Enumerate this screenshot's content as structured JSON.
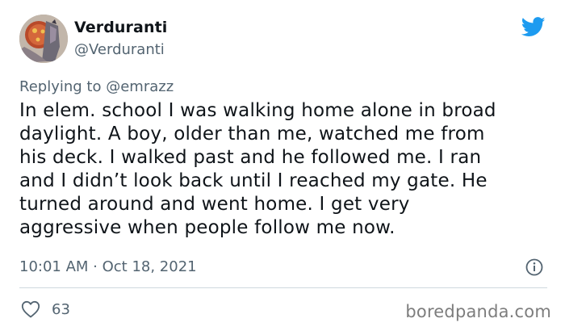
{
  "tweet": {
    "author": {
      "display_name": "Verduranti",
      "handle": "@Verduranti",
      "avatar": "avatar-portrait"
    },
    "platform_icon": "twitter-bird-icon",
    "reply": {
      "prefix": "Replying to",
      "mention": "@emrazz"
    },
    "text_lines": [
      "In elem. school I was walking home alone in broad",
      "daylight. A boy, older than me, watched me from",
      "his deck. I walked past and he followed me. I ran",
      "and I didn’t look back until I reached my gate. He",
      "turned around and went home. I get very",
      "aggressive when people follow me now."
    ],
    "timestamp": "10:01 AM · Oct 18, 2021",
    "info_icon": "info-icon",
    "likes": {
      "icon": "heart-icon",
      "count": "63"
    }
  },
  "watermark": "boredpanda.com",
  "colors": {
    "twitter_blue": "#1d9bf0",
    "secondary_text": "#536471",
    "divider": "#cfd9de"
  }
}
